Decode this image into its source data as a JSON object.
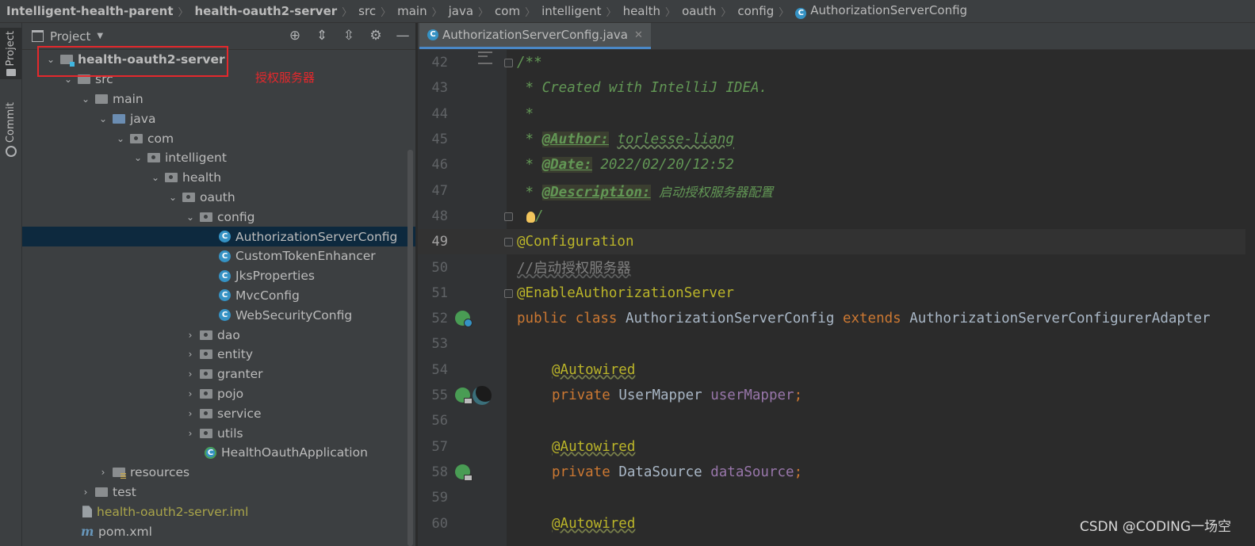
{
  "breadcrumb": {
    "items": [
      "Intelligent-health-parent",
      "health-oauth2-server",
      "src",
      "main",
      "java",
      "com",
      "intelligent",
      "health",
      "oauth",
      "config",
      "AuthorizationServerConfig"
    ]
  },
  "stripe": {
    "project_label": "Project",
    "commit_label": "Commit"
  },
  "project_panel": {
    "title": "Project",
    "annotation_label": "授权服务器",
    "tree": [
      {
        "label": "health-oauth2-server",
        "type": "module",
        "expanded": true
      },
      {
        "label": "src",
        "type": "dir",
        "expanded": true
      },
      {
        "label": "main",
        "type": "dir",
        "expanded": true
      },
      {
        "label": "java",
        "type": "src",
        "expanded": true
      },
      {
        "label": "com",
        "type": "pkg",
        "expanded": true
      },
      {
        "label": "intelligent",
        "type": "pkg",
        "expanded": true
      },
      {
        "label": "health",
        "type": "pkg",
        "expanded": true
      },
      {
        "label": "oauth",
        "type": "pkg",
        "expanded": true
      },
      {
        "label": "config",
        "type": "pkg",
        "expanded": true
      },
      {
        "label": "AuthorizationServerConfig",
        "type": "class",
        "selected": true
      },
      {
        "label": "CustomTokenEnhancer",
        "type": "class"
      },
      {
        "label": "JksProperties",
        "type": "class"
      },
      {
        "label": "MvcConfig",
        "type": "class"
      },
      {
        "label": "WebSecurityConfig",
        "type": "class"
      },
      {
        "label": "dao",
        "type": "pkg",
        "expanded": false
      },
      {
        "label": "entity",
        "type": "pkg",
        "expanded": false
      },
      {
        "label": "granter",
        "type": "pkg",
        "expanded": false
      },
      {
        "label": "pojo",
        "type": "pkg",
        "expanded": false
      },
      {
        "label": "service",
        "type": "pkg",
        "expanded": false
      },
      {
        "label": "utils",
        "type": "pkg",
        "expanded": false
      },
      {
        "label": "HealthOauthApplication",
        "type": "app"
      },
      {
        "label": "resources",
        "type": "res",
        "expanded": false
      },
      {
        "label": "test",
        "type": "dir",
        "expanded": false
      },
      {
        "label": "health-oauth2-server.iml",
        "type": "iml"
      },
      {
        "label": "pom.xml",
        "type": "maven"
      }
    ]
  },
  "editor": {
    "tab_label": "AuthorizationServerConfig.java",
    "current_line": 49,
    "lines": [
      {
        "n": "42",
        "text": "/**"
      },
      {
        "n": "43",
        "text": " * Created with IntelliJ IDEA."
      },
      {
        "n": "44",
        "text": " *"
      },
      {
        "n": "45",
        "tag": "@Author:",
        "value": "torlesse-liang"
      },
      {
        "n": "46",
        "tag": "@Date:",
        "value": "2022/02/20/12:52"
      },
      {
        "n": "47",
        "tag": "@Description:",
        "value": "启动授权服务器配置"
      },
      {
        "n": "48",
        "text": "/"
      },
      {
        "n": "49",
        "text": "@Configuration"
      },
      {
        "n": "50",
        "text": "//启动授权服务器"
      },
      {
        "n": "51",
        "text": "@EnableAuthorizationServer"
      },
      {
        "n": "52",
        "kw": "public class",
        "name": "AuthorizationServerConfig",
        "kw2": "extends",
        "parent": "AuthorizationServerConfigurerAdapter"
      },
      {
        "n": "53",
        "text": ""
      },
      {
        "n": "54",
        "text": "@Autowired"
      },
      {
        "n": "55",
        "kw": "private",
        "type": "UserMapper",
        "field": "userMapper"
      },
      {
        "n": "56",
        "text": ""
      },
      {
        "n": "57",
        "text": "@Autowired"
      },
      {
        "n": "58",
        "kw": "private",
        "type": "DataSource",
        "field": "dataSource"
      },
      {
        "n": "59",
        "text": ""
      },
      {
        "n": "60",
        "text": "@Autowired"
      }
    ]
  },
  "watermark": "CSDN @CODING一场空",
  "colors": {
    "selection": "#0d293e",
    "accent": "#4a88c7",
    "highlight_box": "#e5282c"
  }
}
